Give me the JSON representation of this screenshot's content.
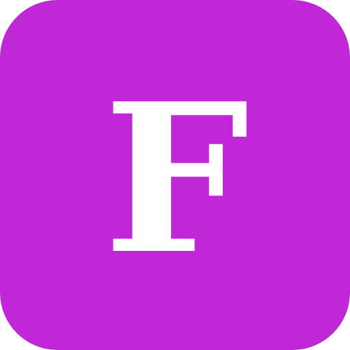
{
  "icon": {
    "letter": "F",
    "background_color": "#BF27D7",
    "letter_color": "#FFFFFF"
  }
}
